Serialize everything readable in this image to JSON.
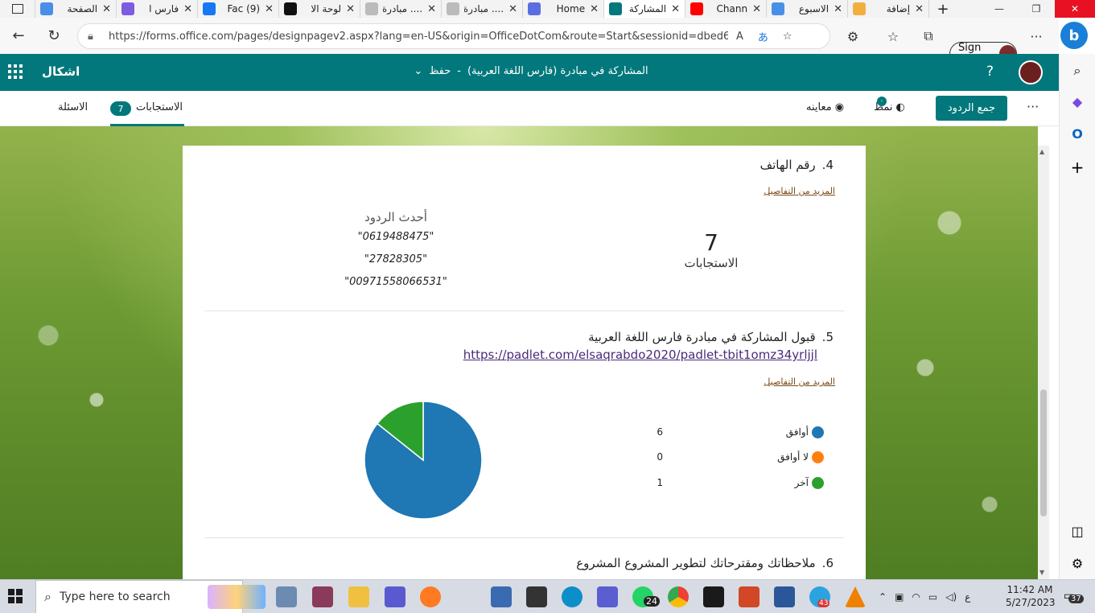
{
  "browser": {
    "tabs": [
      {
        "label": "الصفحة",
        "color": "#4a8fe7"
      },
      {
        "label": "فارس ا",
        "color": "#7c5ce0"
      },
      {
        "label": "(9) Fac",
        "color": "#1877f2"
      },
      {
        "label": "لوحة الا",
        "color": "#111111"
      },
      {
        "label": ".... مبادرة",
        "color": "#bbbbbb"
      },
      {
        "label": ".... مبادرة",
        "color": "#bbbbbb"
      },
      {
        "label": "Home",
        "color": "#5b6ee1"
      },
      {
        "label": "المشاركة",
        "color": "#03787c",
        "active": true
      },
      {
        "label": "Chann",
        "color": "#ff0000"
      },
      {
        "label": "الاسبوع",
        "color": "#4a8fe7"
      },
      {
        "label": "إضافة",
        "color": "#f0b040"
      }
    ],
    "url": "https://forms.office.com/pages/designpagev2.aspx?lang=en-US&origin=OfficeDotCom&route=Start&sessionid=dbed6b68-7...",
    "signin_label": "Sign in"
  },
  "forms_header": {
    "app_name": "اشكال",
    "form_title": "المشاركة في مبادرة (فارس اللغة العربية)",
    "separator": "-",
    "save_status": "حفظ",
    "help": "?"
  },
  "command_bar": {
    "questions_tab": "الاسئلة",
    "responses_tab": "الاستجابات",
    "responses_count": "7",
    "preview_label": "معاينه",
    "theme_label": "نمط",
    "collect_label": "جمع الردود",
    "more": "···"
  },
  "questions": {
    "q4": {
      "number": "4.",
      "title": "رقم الهاتف",
      "more_details": "المزيد من التفاصيل",
      "count": "7",
      "count_label": "الاستجابات",
      "latest_header": "أحدث الردود",
      "latest": [
        "\"0619488475\"",
        "\"27828305\"",
        "\"00971558066531\""
      ]
    },
    "q5": {
      "number": "5.",
      "title": "قبول المشاركة في مبادرة فارس اللغة العربية",
      "link": "https://padlet.com/elsaqrabdo2020/padlet-tbit1omz34yrljjl",
      "more_details": "المزيد من التفاصيل"
    },
    "q6": {
      "number": "6.",
      "title": "ملاحظاتك ومقترحاتك لتطوير المشروع المشروع"
    }
  },
  "chart_data": {
    "type": "pie",
    "categories": [
      "أوافق",
      "لا أوافق",
      "آخر"
    ],
    "values": [
      6,
      0,
      1
    ],
    "colors": [
      "#1f77b4",
      "#ff7f0e",
      "#2ca02c"
    ],
    "legend": "right"
  },
  "taskbar": {
    "search_placeholder": "Type here to search",
    "whatsapp_badge": "24",
    "telegram_badge": "43",
    "lang": "ع",
    "time": "11:42 AM",
    "date": "5/27/2023",
    "notifications": "37"
  }
}
